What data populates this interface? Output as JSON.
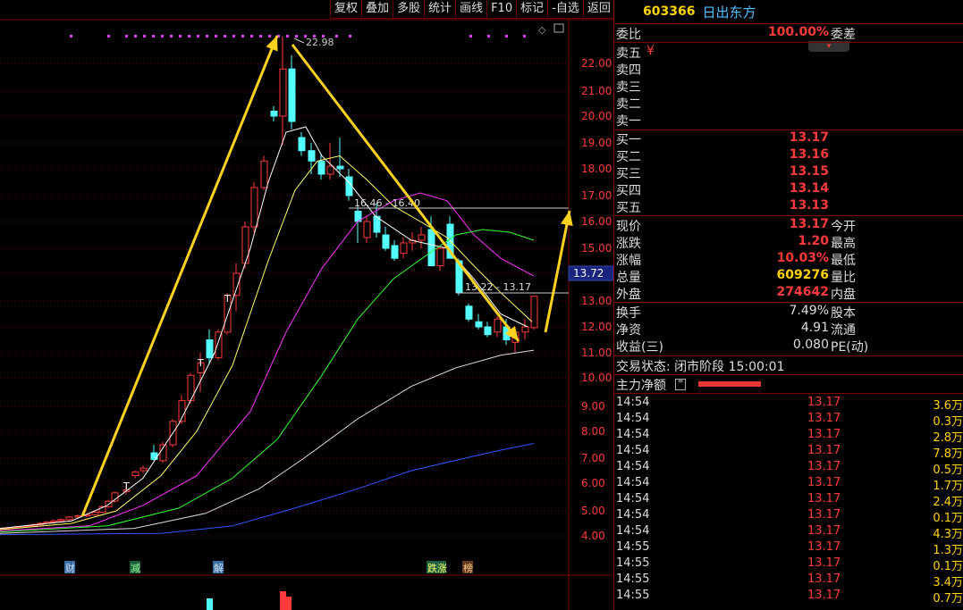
{
  "toolbar": [
    "复权",
    "叠加",
    "多股",
    "统计",
    "画线",
    "F10",
    "标记",
    "-自选",
    "返回"
  ],
  "chart": {
    "y_labels": [
      "22.00",
      "21.00",
      "20.00",
      "19.00",
      "18.00",
      "17.00",
      "16.00",
      "15.00",
      "14.00",
      "13.00",
      "12.00",
      "11.00",
      "10.00",
      "9.00",
      "8.00",
      "7.00",
      "6.00",
      "5.00",
      "4.00"
    ],
    "peak_label": "22.98",
    "range_label_1": "16.46 - 16.40",
    "range_label_2": "13.22 - 13.17",
    "current_price_tag": "13.72",
    "event_labels": [
      "财",
      "减",
      "解",
      "跌涨",
      "榜"
    ]
  },
  "panel": {
    "code": "603366",
    "name": "日出东方",
    "weibi_label": "委比",
    "weibi_value": "100.00%",
    "weicha_label": "委差",
    "sell": [
      {
        "label": "卖五",
        "price": "¥"
      },
      {
        "label": "卖四",
        "price": ""
      },
      {
        "label": "卖三",
        "price": ""
      },
      {
        "label": "卖二",
        "price": ""
      },
      {
        "label": "卖一",
        "price": ""
      }
    ],
    "buy": [
      {
        "label": "买一",
        "price": "13.17"
      },
      {
        "label": "买二",
        "price": "13.16"
      },
      {
        "label": "买三",
        "price": "13.15"
      },
      {
        "label": "买四",
        "price": "13.14"
      },
      {
        "label": "买五",
        "price": "13.13"
      }
    ],
    "stats": [
      {
        "label": "现价",
        "value": "13.17",
        "color": "red",
        "label2": "今开"
      },
      {
        "label": "涨跌",
        "value": "1.20",
        "color": "red",
        "label2": "最高"
      },
      {
        "label": "涨幅",
        "value": "10.03%",
        "color": "red",
        "label2": "最低"
      },
      {
        "label": "总量",
        "value": "609276",
        "color": "yel",
        "label2": "量比"
      },
      {
        "label": "外盘",
        "value": "274642",
        "color": "red",
        "label2": "内盘"
      }
    ],
    "stats2": [
      {
        "label": "换手",
        "value": "7.49%",
        "label2": "股本"
      },
      {
        "label": "净资",
        "value": "4.91",
        "label2": "流通"
      },
      {
        "label": "收益(三)",
        "value": "0.080",
        "label2": "PE(动)"
      }
    ],
    "trade_status": "交易状态: 闭市阶段 15:00:01",
    "main_flow_label": "主力净额",
    "ticks": [
      {
        "time": "14:54",
        "price": "13.17",
        "vol": "3.6万"
      },
      {
        "time": "14:54",
        "price": "13.17",
        "vol": "0.3万"
      },
      {
        "time": "14:54",
        "price": "13.17",
        "vol": "2.8万"
      },
      {
        "time": "14:54",
        "price": "13.17",
        "vol": "7.8万"
      },
      {
        "time": "14:54",
        "price": "13.17",
        "vol": "0.5万"
      },
      {
        "time": "14:54",
        "price": "13.17",
        "vol": "1.7万"
      },
      {
        "time": "14:54",
        "price": "13.17",
        "vol": "2.4万"
      },
      {
        "time": "14:54",
        "price": "13.17",
        "vol": "0.1万"
      },
      {
        "time": "14:54",
        "price": "13.17",
        "vol": "4.3万"
      },
      {
        "time": "14:55",
        "price": "13.17",
        "vol": "1.3万"
      },
      {
        "time": "14:55",
        "price": "13.17",
        "vol": "0.1万"
      },
      {
        "time": "14:55",
        "price": "13.17",
        "vol": "3.4万"
      },
      {
        "time": "14:55",
        "price": "13.17",
        "vol": "0.7万"
      }
    ]
  }
}
